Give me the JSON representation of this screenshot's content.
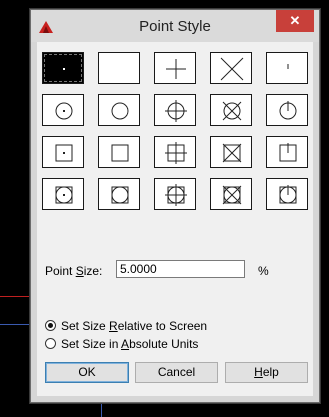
{
  "dialog": {
    "title": "Point Style",
    "close_glyph": "✕",
    "app_icon": "autocad-icon"
  },
  "styles": {
    "rows": [
      [
        {
          "mark": "dot",
          "outer": "none",
          "selected": true
        },
        {
          "mark": "none",
          "outer": "none",
          "selected": false
        },
        {
          "mark": "plus",
          "outer": "none",
          "selected": false
        },
        {
          "mark": "x",
          "outer": "none",
          "selected": false
        },
        {
          "mark": "tick",
          "outer": "none",
          "selected": false
        }
      ],
      [
        {
          "mark": "dot",
          "outer": "circle",
          "selected": false
        },
        {
          "mark": "none",
          "outer": "circle",
          "selected": false
        },
        {
          "mark": "plus",
          "outer": "circle",
          "selected": false
        },
        {
          "mark": "x",
          "outer": "circle",
          "selected": false
        },
        {
          "mark": "tick",
          "outer": "circle",
          "selected": false
        }
      ],
      [
        {
          "mark": "dot",
          "outer": "square",
          "selected": false
        },
        {
          "mark": "none",
          "outer": "square",
          "selected": false
        },
        {
          "mark": "plus",
          "outer": "square",
          "selected": false
        },
        {
          "mark": "x",
          "outer": "square",
          "selected": false
        },
        {
          "mark": "tick",
          "outer": "square",
          "selected": false
        }
      ],
      [
        {
          "mark": "dot",
          "outer": "both",
          "selected": false
        },
        {
          "mark": "none",
          "outer": "both",
          "selected": false
        },
        {
          "mark": "plus",
          "outer": "both",
          "selected": false
        },
        {
          "mark": "x",
          "outer": "both",
          "selected": false
        },
        {
          "mark": "tick",
          "outer": "both",
          "selected": false
        }
      ]
    ]
  },
  "point_size": {
    "label_pre": "Point ",
    "label_ul": "S",
    "label_post": "ize:",
    "value": "5.0000",
    "unit": "%"
  },
  "size_mode": {
    "relative": {
      "pre": "Set Size ",
      "ul": "R",
      "post": "elative to Screen",
      "checked": true
    },
    "absolute": {
      "pre": "Set Size in ",
      "ul": "A",
      "post": "bsolute Units",
      "checked": false
    }
  },
  "buttons": {
    "ok": "OK",
    "cancel": "Cancel",
    "help_ul": "H",
    "help_rest": "elp"
  },
  "colors": {
    "close_bg": "#c8403a",
    "app_icon_red": "#c8201e"
  }
}
